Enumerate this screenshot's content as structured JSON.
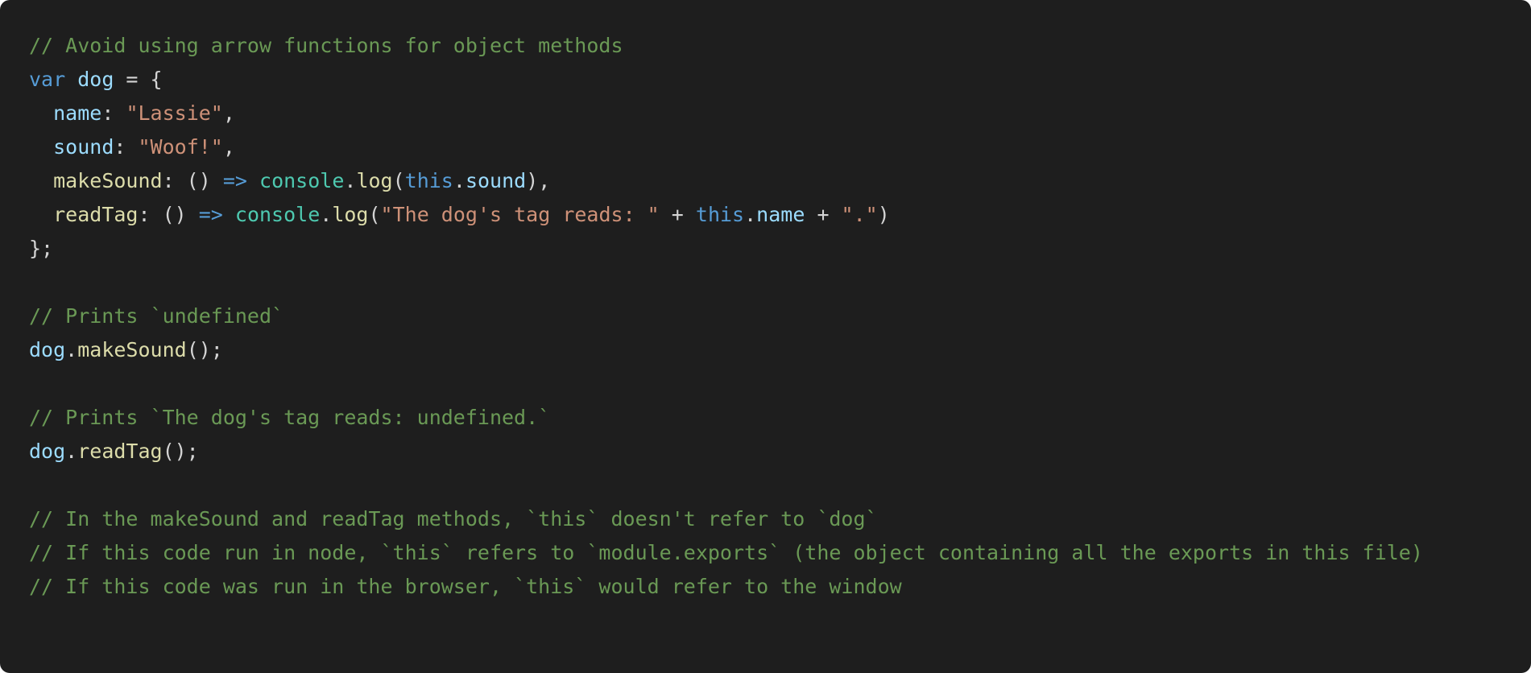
{
  "colors": {
    "background": "#1e1e1e",
    "comment": "#6a9955",
    "keyword": "#569cd6",
    "variable": "#9cdcfe",
    "string": "#ce9178",
    "function": "#dcdcaa",
    "class": "#4ec9b0",
    "punctuation": "#d4d4d4"
  },
  "code_lines": [
    [
      {
        "t": "// Avoid using arrow functions for object methods",
        "k": "comment"
      }
    ],
    [
      {
        "t": "var",
        "k": "keyword"
      },
      {
        "t": " ",
        "k": "punct"
      },
      {
        "t": "dog",
        "k": "var"
      },
      {
        "t": " = {",
        "k": "punct"
      }
    ],
    [
      {
        "t": "  ",
        "k": "punct"
      },
      {
        "t": "name",
        "k": "var"
      },
      {
        "t": ": ",
        "k": "punct"
      },
      {
        "t": "\"Lassie\"",
        "k": "string"
      },
      {
        "t": ",",
        "k": "punct"
      }
    ],
    [
      {
        "t": "  ",
        "k": "punct"
      },
      {
        "t": "sound",
        "k": "var"
      },
      {
        "t": ": ",
        "k": "punct"
      },
      {
        "t": "\"Woof!\"",
        "k": "string"
      },
      {
        "t": ",",
        "k": "punct"
      }
    ],
    [
      {
        "t": "  ",
        "k": "punct"
      },
      {
        "t": "makeSound",
        "k": "func"
      },
      {
        "t": ": () ",
        "k": "punct"
      },
      {
        "t": "=>",
        "k": "keyword"
      },
      {
        "t": " ",
        "k": "punct"
      },
      {
        "t": "console",
        "k": "class"
      },
      {
        "t": ".",
        "k": "punct"
      },
      {
        "t": "log",
        "k": "func"
      },
      {
        "t": "(",
        "k": "punct"
      },
      {
        "t": "this",
        "k": "keyword"
      },
      {
        "t": ".",
        "k": "punct"
      },
      {
        "t": "sound",
        "k": "var"
      },
      {
        "t": "),",
        "k": "punct"
      }
    ],
    [
      {
        "t": "  ",
        "k": "punct"
      },
      {
        "t": "readTag",
        "k": "func"
      },
      {
        "t": ": () ",
        "k": "punct"
      },
      {
        "t": "=>",
        "k": "keyword"
      },
      {
        "t": " ",
        "k": "punct"
      },
      {
        "t": "console",
        "k": "class"
      },
      {
        "t": ".",
        "k": "punct"
      },
      {
        "t": "log",
        "k": "func"
      },
      {
        "t": "(",
        "k": "punct"
      },
      {
        "t": "\"The dog's tag reads: \"",
        "k": "string"
      },
      {
        "t": " + ",
        "k": "punct"
      },
      {
        "t": "this",
        "k": "keyword"
      },
      {
        "t": ".",
        "k": "punct"
      },
      {
        "t": "name",
        "k": "var"
      },
      {
        "t": " + ",
        "k": "punct"
      },
      {
        "t": "\".\"",
        "k": "string"
      },
      {
        "t": ")",
        "k": "punct"
      }
    ],
    [
      {
        "t": "};",
        "k": "punct"
      }
    ],
    [],
    [
      {
        "t": "// Prints `undefined`",
        "k": "comment"
      }
    ],
    [
      {
        "t": "dog",
        "k": "var"
      },
      {
        "t": ".",
        "k": "punct"
      },
      {
        "t": "makeSound",
        "k": "func"
      },
      {
        "t": "();",
        "k": "punct"
      }
    ],
    [],
    [
      {
        "t": "// Prints `The dog's tag reads: undefined.`",
        "k": "comment"
      }
    ],
    [
      {
        "t": "dog",
        "k": "var"
      },
      {
        "t": ".",
        "k": "punct"
      },
      {
        "t": "readTag",
        "k": "func"
      },
      {
        "t": "();",
        "k": "punct"
      }
    ],
    [],
    [
      {
        "t": "// In the makeSound and readTag methods, `this` doesn't refer to `dog`",
        "k": "comment"
      }
    ],
    [
      {
        "t": "// If this code run in node, `this` refers to `module.exports` (the object containing all the exports in this file)",
        "k": "comment"
      }
    ],
    [
      {
        "t": "// If this code was run in the browser, `this` would refer to the window",
        "k": "comment"
      }
    ]
  ]
}
